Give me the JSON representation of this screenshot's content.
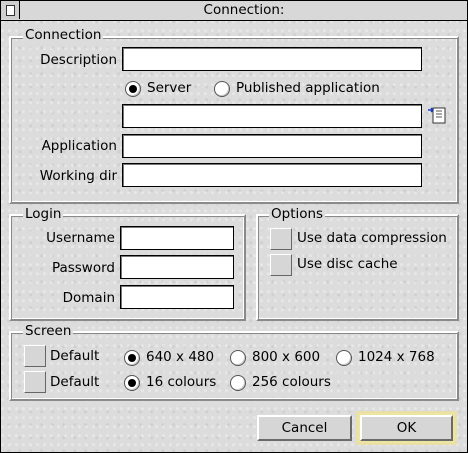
{
  "window": {
    "title": "Connection:"
  },
  "connection": {
    "title": "Connection",
    "description_label": "Description",
    "description_value": "",
    "server_label": "Server",
    "published_label": "Published application",
    "server_selected": true,
    "server_value": "",
    "application_label": "Application",
    "application_value": "",
    "workdir_label": "Working dir",
    "workdir_value": ""
  },
  "login": {
    "title": "Login",
    "username_label": "Username",
    "username_value": "",
    "password_label": "Password",
    "password_value": "",
    "domain_label": "Domain",
    "domain_value": ""
  },
  "options": {
    "title": "Options",
    "compression_label": "Use data compression",
    "compression_checked": false,
    "disc_cache_label": "Use disc cache",
    "disc_cache_checked": false
  },
  "screen": {
    "title": "Screen",
    "default_label_1": "Default",
    "default_label_2": "Default",
    "res_640": "640 x 480",
    "res_800": "800 x 600",
    "res_1024": "1024 x 768",
    "selected_resolution": "640 x 480",
    "col_16": "16 colours",
    "col_256": "256 colours",
    "selected_colours": "16 colours"
  },
  "buttons": {
    "cancel": "Cancel",
    "ok": "OK"
  },
  "colors": {
    "window_bg": "#dcdcdc",
    "ok_highlight": "#ede4a0"
  }
}
